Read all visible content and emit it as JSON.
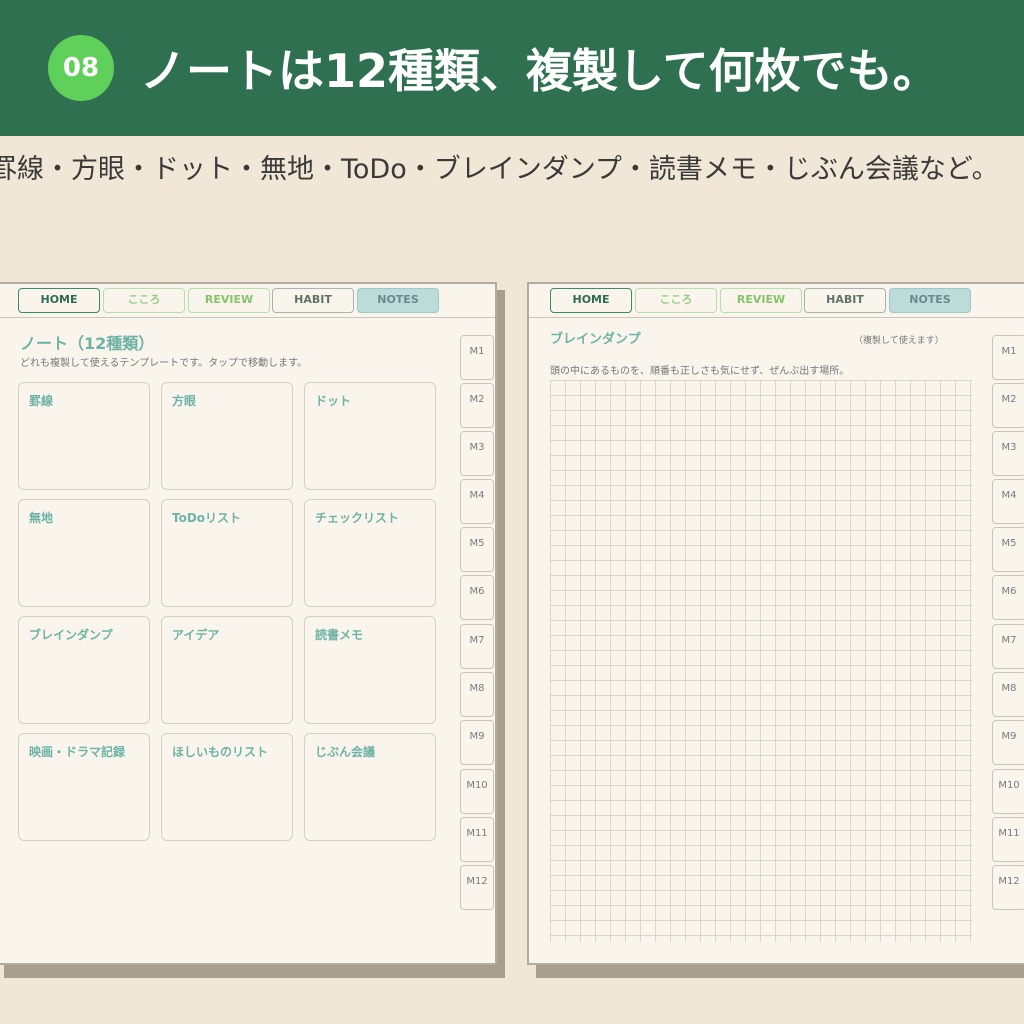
{
  "header": {
    "badge": "08",
    "headline": "ノートは12種類、複製して何枚でも。"
  },
  "subline": "罫線・方眼・ドット・無地・ToDo・ブレインダンプ・読書メモ・じぶん会議など。",
  "tabs": [
    "HOME",
    "こころ",
    "REVIEW",
    "HABIT",
    "NOTES"
  ],
  "side_tabs": [
    "M1",
    "M2",
    "M3",
    "M4",
    "M5",
    "M6",
    "M7",
    "M8",
    "M9",
    "M10",
    "M11",
    "M12"
  ],
  "left_page": {
    "title": "ノート（12種類）",
    "description": "どれも複製して使えるテンプレートです。タップで移動します。",
    "cards": [
      "罫線",
      "方眼",
      "ドット",
      "無地",
      "ToDoリスト",
      "チェックリスト",
      "ブレインダンプ",
      "アイデア",
      "読書メモ",
      "映画・ドラマ記録",
      "ほしいものリスト",
      "じぶん会議"
    ]
  },
  "right_page": {
    "title": "ブレインダンプ",
    "note": "（複製して使えます）",
    "description": "頭の中にあるものを、順番も正しさも気にせず、ぜんぶ出す場所。"
  },
  "colors": {
    "header_bg": "#2e7050",
    "badge_bg": "#5fd05a",
    "background": "#f1e7d7",
    "accent_teal": "#6fb3a6"
  }
}
